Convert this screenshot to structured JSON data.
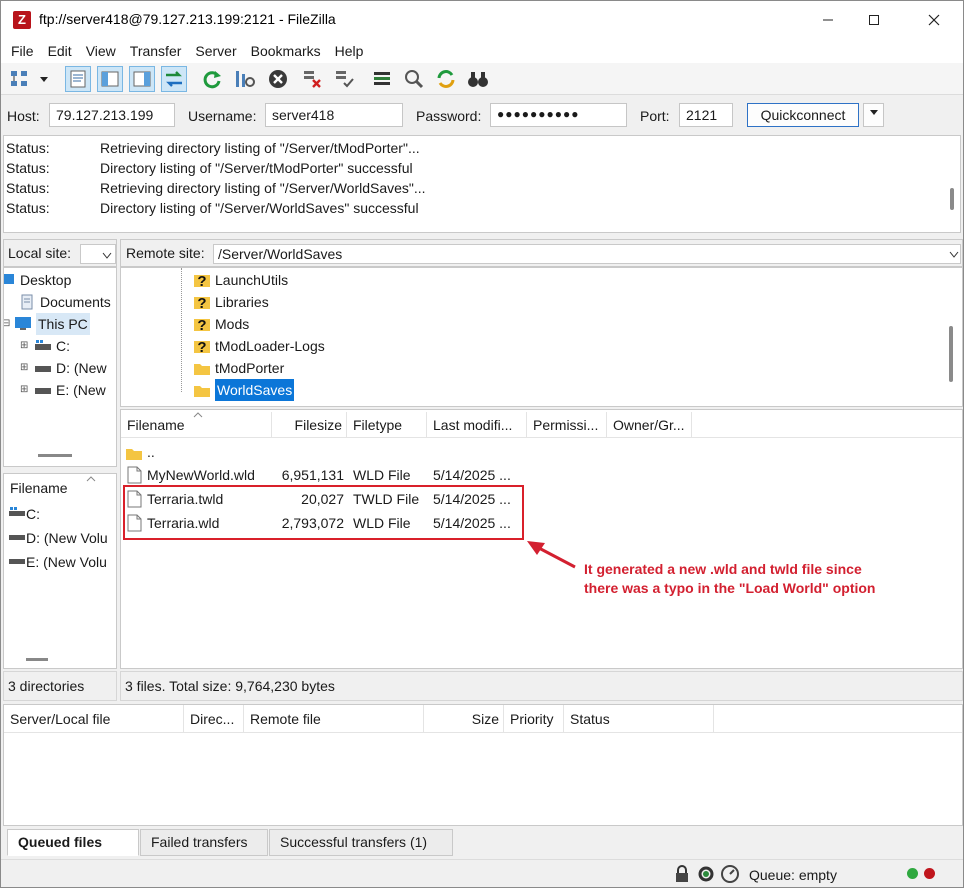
{
  "window": {
    "app_icon": "Z",
    "title": "ftp://server418@79.127.213.199:2121 - FileZilla"
  },
  "menu": [
    "File",
    "Edit",
    "View",
    "Transfer",
    "Server",
    "Bookmarks",
    "Help"
  ],
  "quickconnect": {
    "host_label": "Host:",
    "host_value": "79.127.213.199",
    "username_label": "Username:",
    "username_value": "server418",
    "password_label": "Password:",
    "password_value": "●●●●●●●●●●",
    "port_label": "Port:",
    "port_value": "2121",
    "connect_label": "Quickconnect"
  },
  "log": [
    {
      "status": "Status:",
      "message": "Retrieving directory listing of \"/Server/tModPorter\"..."
    },
    {
      "status": "Status:",
      "message": "Directory listing of \"/Server/tModPorter\" successful"
    },
    {
      "status": "Status:",
      "message": "Retrieving directory listing of \"/Server/WorldSaves\"..."
    },
    {
      "status": "Status:",
      "message": "Directory listing of \"/Server/WorldSaves\" successful"
    }
  ],
  "local": {
    "site_label": "Local site:",
    "site_value": "",
    "tree": [
      {
        "label": "Desktop",
        "icon": "desktop-folder-icon"
      },
      {
        "label": "Documents",
        "icon": "documents-icon"
      },
      {
        "label": "This PC",
        "icon": "computer-icon"
      },
      {
        "label": "C:",
        "icon": "drive-icon"
      },
      {
        "label": "D: (New",
        "icon": "drive-icon"
      },
      {
        "label": "E: (New",
        "icon": "drive-icon"
      }
    ],
    "files_header": "Filename",
    "files": [
      "C:",
      "D: (New Volu",
      "E: (New Volu"
    ],
    "status": "3 directories"
  },
  "remote": {
    "site_label": "Remote site:",
    "site_value": "/Server/WorldSaves",
    "tree": [
      {
        "label": "LaunchUtils",
        "icon": "unknown-folder-icon"
      },
      {
        "label": "Libraries",
        "icon": "unknown-folder-icon"
      },
      {
        "label": "Mods",
        "icon": "unknown-folder-icon"
      },
      {
        "label": "tModLoader-Logs",
        "icon": "unknown-folder-icon"
      },
      {
        "label": "tModPorter",
        "icon": "folder-icon"
      },
      {
        "label": "WorldSaves",
        "icon": "folder-icon"
      }
    ],
    "columns": [
      "Filename",
      "Filesize",
      "Filetype",
      "Last modifi...",
      "Permissi...",
      "Owner/Gr..."
    ],
    "parent_dir": "..",
    "files": [
      {
        "name": "MyNewWorld.wld",
        "size": "6,951,131",
        "type": "WLD File",
        "modified": "5/14/2025 ..."
      },
      {
        "name": "Terraria.twld",
        "size": "20,027",
        "type": "TWLD File",
        "modified": "5/14/2025 ..."
      },
      {
        "name": "Terraria.wld",
        "size": "2,793,072",
        "type": "WLD File",
        "modified": "5/14/2025 ..."
      }
    ],
    "status": "3 files. Total size: 9,764,230 bytes"
  },
  "annotation": {
    "line1": "It generated a new .wld and twld file since",
    "line2": "there was a typo in the \"Load World\" option",
    "color": "#d32030"
  },
  "queue": {
    "columns": [
      "Server/Local file",
      "Direc...",
      "Remote file",
      "Size",
      "Priority",
      "Status"
    ],
    "tabs": [
      "Queued files",
      "Failed transfers",
      "Successful transfers (1)"
    ],
    "status": "Queue: empty"
  }
}
